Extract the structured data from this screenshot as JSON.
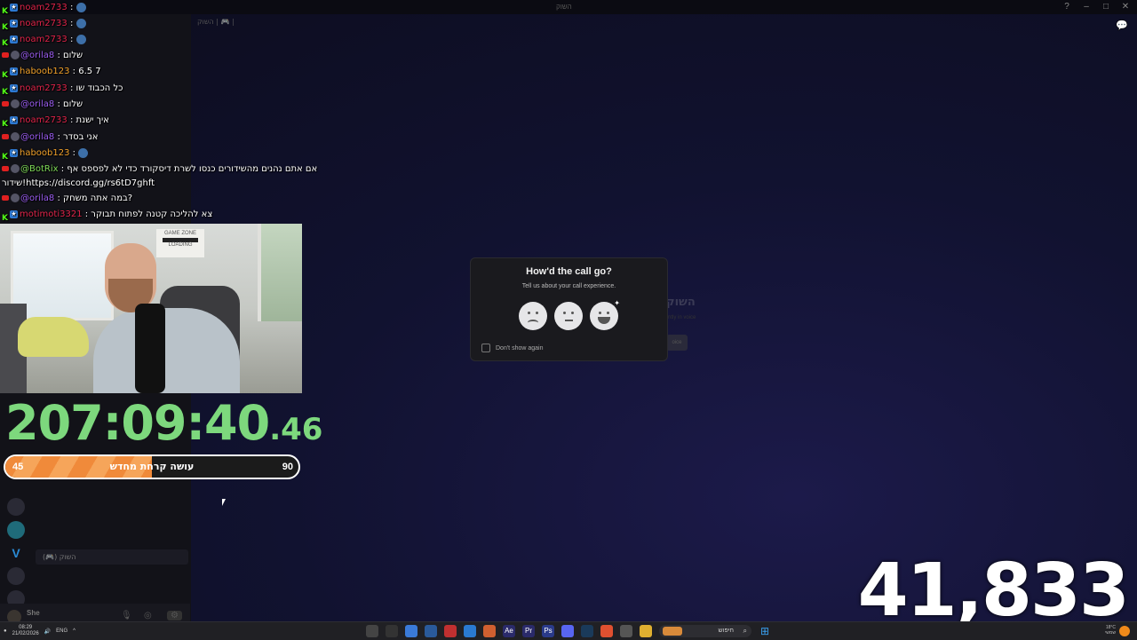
{
  "discord": {
    "window_title": "השוק",
    "channel_header": "השוק | 🎮 |",
    "behind_title": "השוק",
    "behind_sub": "ntly in voice",
    "behind_button": "oice",
    "channels": [
      "",
      "",
      "",
      "",
      "(🎮) השוק",
      "",
      "",
      ""
    ],
    "user_name": "She"
  },
  "chat": [
    {
      "platform": "kick",
      "user": "noam2733",
      "user_color": "red",
      "message": ""
    },
    {
      "platform": "kick",
      "user": "noam2733",
      "user_color": "red",
      "message": ""
    },
    {
      "platform": "kick",
      "user": "noam2733",
      "user_color": "red",
      "message": ""
    },
    {
      "platform": "youtube",
      "user": "@orila8",
      "user_color": "purple",
      "message": "שלום"
    },
    {
      "platform": "kick",
      "user": "haboob123",
      "user_color": "orange",
      "message": "6.5 7"
    },
    {
      "platform": "kick",
      "user": "noam2733",
      "user_color": "red",
      "message": "כל הכבוד שו"
    },
    {
      "platform": "youtube",
      "user": "@orila8",
      "user_color": "purple",
      "message": "שלום"
    },
    {
      "platform": "kick",
      "user": "noam2733",
      "user_color": "red",
      "message": "איך ישנת"
    },
    {
      "platform": "youtube",
      "user": "@orila8",
      "user_color": "purple",
      "message": "אני בסדר"
    },
    {
      "platform": "kick",
      "user": "haboob123",
      "user_color": "orange",
      "message": ""
    },
    {
      "platform": "youtube",
      "user": "@BotRix",
      "user_color": "green",
      "message": "אם אתם נהנים מהשידורים כנסו לשרת דיסקורד כדי לא לפספס אף"
    },
    {
      "platform": "none",
      "user": "",
      "user_color": "white",
      "message": "שידור!https://discord.gg/rs6tD7ghft"
    },
    {
      "platform": "youtube",
      "user": "@orila8",
      "user_color": "purple",
      "message": "במה אתה משחק?"
    },
    {
      "platform": "kick",
      "user": "motimoti3321",
      "user_color": "red",
      "message": "צא להליכה קטנה לפתוח תבוקר"
    }
  ],
  "webcam": {
    "poster_line1": "GAME ZONE",
    "poster_line2": "LOADING"
  },
  "timer": {
    "main": "207:09:40",
    "fraction": ".46"
  },
  "progress": {
    "label": "עושה קרחת מחדש",
    "current": "45",
    "max": "90",
    "fraction": 0.5
  },
  "viewer_count": "41,833",
  "modal": {
    "title": "How'd the call go?",
    "subtitle": "Tell us about your call experience.",
    "options": [
      "sad-face",
      "neutral-face",
      "happy-face"
    ],
    "checkbox_label": "Don't show again",
    "checkbox_checked": false
  },
  "taskbar": {
    "time": "08:29",
    "date": "21/02/2026",
    "language": "ENG",
    "search_placeholder": "חיפוש",
    "weather_temp": "18°C",
    "weather_desc": "שמשי"
  },
  "colors": {
    "timer": "#7dd87d",
    "progress_fill": "#f08a3a",
    "kick_green": "#53fc18",
    "youtube_red": "#e02020",
    "discord_bg": "#111230"
  }
}
